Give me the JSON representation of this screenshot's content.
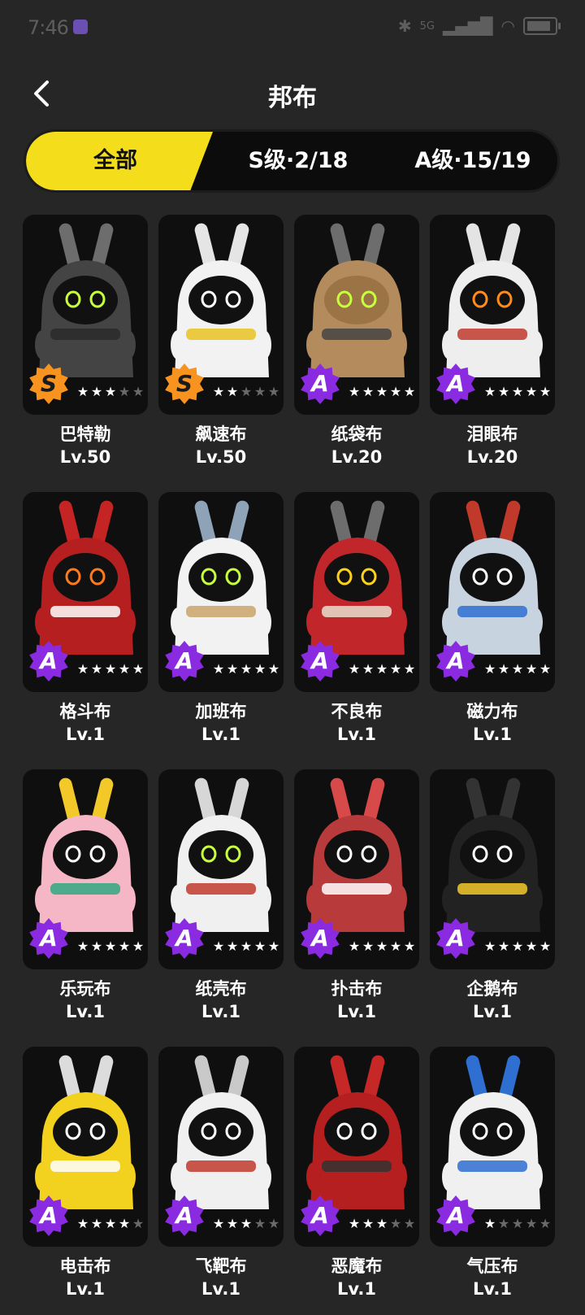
{
  "status_bar": {
    "time": "7:46",
    "network": "5G"
  },
  "header": {
    "title": "邦布"
  },
  "tabs": [
    {
      "label": "全部",
      "active": true
    },
    {
      "label": "S级·2/18",
      "active": false
    },
    {
      "label": "A级·15/19",
      "active": false
    }
  ],
  "colors": {
    "accent": "#f4dd1b",
    "s_rank": "#f7931e",
    "a_rank": "#8a2be2"
  },
  "bangboos": [
    {
      "name": "巴特勒",
      "level": "Lv.50",
      "rank": "S",
      "stars": 3,
      "body": "#444444",
      "ears": "#6d6d6d",
      "face": "#111111",
      "eyes": "#c8ff3c",
      "accent": "#2a2a2a",
      "icon": "butler-bangboo-icon"
    },
    {
      "name": "飙速布",
      "level": "Lv.50",
      "rank": "S",
      "stars": 2,
      "body": "#f2f2f2",
      "ears": "#e5e5e5",
      "face": "#111111",
      "eyes": "#ffffff",
      "accent": "#e8c321",
      "icon": "racer-bangboo-icon"
    },
    {
      "name": "纸袋布",
      "level": "Lv.20",
      "rank": "A",
      "stars": 5,
      "body": "#b48b5d",
      "ears": "#6d6d6d",
      "face": "#9b7446",
      "eyes": "#c8ff3c",
      "accent": "#444444",
      "icon": "paperbag-bangboo-icon"
    },
    {
      "name": "泪眼布",
      "level": "Lv.20",
      "rank": "A",
      "stars": 5,
      "body": "#eeeeee",
      "ears": "#e4e4e4",
      "face": "#111111",
      "eyes": "#ff8c1a",
      "accent": "#c0392b",
      "icon": "teary-bangboo-icon"
    },
    {
      "name": "格斗布",
      "level": "Lv.1",
      "rank": "A",
      "stars": 5,
      "body": "#b51f1f",
      "ears": "#c42424",
      "face": "#111111",
      "eyes": "#ff7a1a",
      "accent": "#ffffff",
      "icon": "fighter-bangboo-icon"
    },
    {
      "name": "加班布",
      "level": "Lv.1",
      "rank": "A",
      "stars": 5,
      "body": "#f2f2f2",
      "ears": "#8fa3b8",
      "face": "#111111",
      "eyes": "#c8ff3c",
      "accent": "#c9a56a",
      "icon": "overtime-bangboo-icon"
    },
    {
      "name": "不良布",
      "level": "Lv.1",
      "rank": "A",
      "stars": 5,
      "body": "#c0262a",
      "ears": "#6d6d6d",
      "face": "#111111",
      "eyes": "#ffd21a",
      "accent": "#e8e0d0",
      "icon": "delinquent-bangboo-icon"
    },
    {
      "name": "磁力布",
      "level": "Lv.1",
      "rank": "A",
      "stars": 5,
      "body": "#c7d3df",
      "ears": "#c0392b",
      "face": "#111111",
      "eyes": "#ffffff",
      "accent": "#2f6fd1",
      "icon": "magnet-bangboo-icon"
    },
    {
      "name": "乐玩布",
      "level": "Lv.1",
      "rank": "A",
      "stars": 5,
      "body": "#f5b7c6",
      "ears": "#f2c928",
      "face": "#111111",
      "eyes": "#ffffff",
      "accent": "#2fa87f",
      "icon": "toy-bangboo-icon"
    },
    {
      "name": "纸壳布",
      "level": "Lv.1",
      "rank": "A",
      "stars": 5,
      "body": "#f0f0f0",
      "ears": "#d7d7d7",
      "face": "#111111",
      "eyes": "#c8ff3c",
      "accent": "#c0392b",
      "icon": "cardboard-bangboo-icon"
    },
    {
      "name": "扑击布",
      "level": "Lv.1",
      "rank": "A",
      "stars": 5,
      "body": "#b83a3a",
      "ears": "#d84a4a",
      "face": "#111111",
      "eyes": "#ffffff",
      "accent": "#ffffff",
      "icon": "pounce-bangboo-icon"
    },
    {
      "name": "企鹅布",
      "level": "Lv.1",
      "rank": "A",
      "stars": 5,
      "body": "#222222",
      "ears": "#333333",
      "face": "#111111",
      "eyes": "#ffffff",
      "accent": "#f2c928",
      "icon": "penguin-bangboo-icon"
    },
    {
      "name": "电击布",
      "level": "Lv.1",
      "rank": "A",
      "stars": 4,
      "body": "#f2d21f",
      "ears": "#dcdcdc",
      "face": "#111111",
      "eyes": "#ffffff",
      "accent": "#ffffff",
      "icon": "shock-bangboo-icon"
    },
    {
      "name": "飞靶布",
      "level": "Lv.1",
      "rank": "A",
      "stars": 3,
      "body": "#f0f0f0",
      "ears": "#c9c9c9",
      "face": "#111111",
      "eyes": "#ffffff",
      "accent": "#c0392b",
      "icon": "target-bangboo-icon"
    },
    {
      "name": "恶魔布",
      "level": "Lv.1",
      "rank": "A",
      "stars": 3,
      "body": "#b51f1f",
      "ears": "#c62828",
      "face": "#111111",
      "eyes": "#ffffff",
      "accent": "#333333",
      "icon": "devil-bangboo-icon"
    },
    {
      "name": "气压布",
      "level": "Lv.1",
      "rank": "A",
      "stars": 1,
      "body": "#f0f0f0",
      "ears": "#2f6fd1",
      "face": "#111111",
      "eyes": "#ffffff",
      "accent": "#2f6fd1",
      "icon": "pressure-bangboo-icon"
    }
  ]
}
